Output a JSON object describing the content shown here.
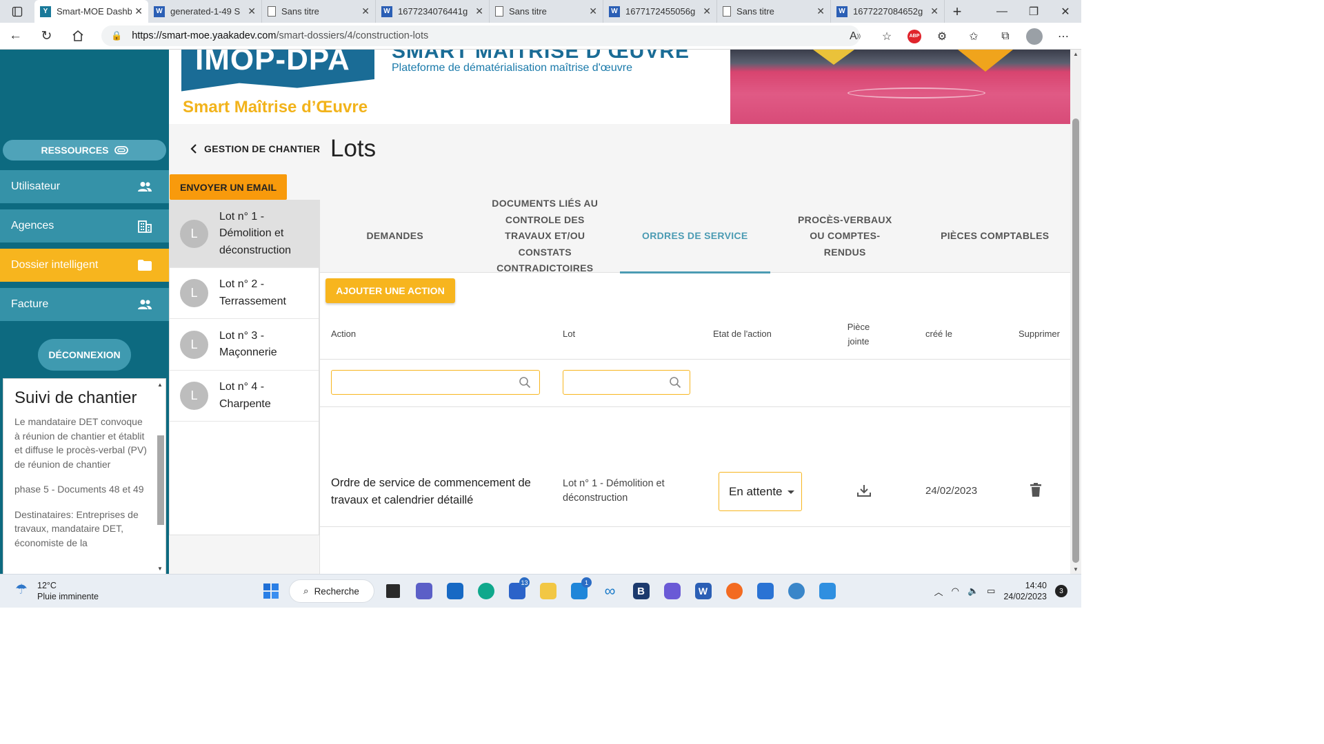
{
  "browser": {
    "tabs": [
      {
        "label": "Smart-MOE Dashb",
        "icon": "yaaka-favicon",
        "active": true
      },
      {
        "label": "generated-1-49 S",
        "icon": "word-favicon"
      },
      {
        "label": "Sans titre",
        "icon": "document-favicon"
      },
      {
        "label": "1677234076441g",
        "icon": "word-favicon"
      },
      {
        "label": "Sans titre",
        "icon": "document-favicon"
      },
      {
        "label": "1677172455056g",
        "icon": "word-favicon"
      },
      {
        "label": "Sans titre",
        "icon": "document-favicon"
      },
      {
        "label": "1677227084652g",
        "icon": "word-favicon"
      }
    ],
    "url_host": "https://smart-moe.yaakadev.com",
    "url_path": "/smart-dossiers/4/construction-lots",
    "abp_label": "ABP"
  },
  "header": {
    "logo_text": "IMOP-DPA",
    "logo_tagline": "Smart Maîtrise d’Œuvre",
    "site_title": "SMART MAÎTRISE D’ŒUVRE",
    "site_subtitle": "Plateforme de dématérialisation maîtrise d'œuvre"
  },
  "sidebar": {
    "resources_label": "RESSOURCES",
    "items": [
      {
        "label": "Utilisateur",
        "icon": "users-icon"
      },
      {
        "label": "Agences",
        "icon": "building-icon"
      },
      {
        "label": "Dossier intelligent",
        "icon": "folder-icon",
        "active": true
      },
      {
        "label": "Facture",
        "icon": "users-icon"
      }
    ],
    "logout_label": "DÉCONNEXION",
    "info": {
      "title": "Suivi de chantier",
      "p1": "Le mandataire DET convoque à réunion de chantier et établit et diffuse le procès-verbal (PV) de réunion de chantier",
      "p2": "phase 5 - Documents 48 et 49",
      "p3": "Destinataires: Entreprises de travaux, mandataire DET, économiste de la"
    }
  },
  "main": {
    "back_label": "GESTION DE CHANTIER",
    "title": "Lots",
    "email_button": "ENVOYER UN EMAIL",
    "lots": [
      {
        "avatar": "L",
        "label": "Lot n° 1 - Démolition et déconstruction",
        "selected": true
      },
      {
        "avatar": "L",
        "label": "Lot n° 2 - Terrassement"
      },
      {
        "avatar": "L",
        "label": "Lot n° 3 - Maçonnerie"
      },
      {
        "avatar": "L",
        "label": "Lot n° 4 - Charpente"
      }
    ],
    "tabs": [
      {
        "label": "DEMANDES"
      },
      {
        "label": "DOCUMENTS LIÉS AU CONTROLE DES TRAVAUX ET/OU CONSTATS CONTRADICTOIRES"
      },
      {
        "label": "ORDRES DE SERVICE",
        "active": true
      },
      {
        "label": "PROCÈS-VERBAUX OU COMPTES-RENDUS"
      },
      {
        "label": "PIÈCES COMPTABLES"
      }
    ],
    "add_action_button": "AJOUTER UNE ACTION",
    "table": {
      "headers": {
        "action": "Action",
        "lot": "Lot",
        "state": "Etat de l'action",
        "attachment": "Pièce jointe",
        "created": "créé le",
        "delete": "Supprimer"
      },
      "rows": [
        {
          "action": "Ordre de service de commencement de travaux et calendrier détaillé",
          "lot": "Lot n° 1 - Démolition et déconstruction",
          "state": "En attente",
          "created": "24/02/2023"
        }
      ]
    }
  },
  "taskbar": {
    "temperature": "12°C",
    "weather": "Pluie imminente",
    "search_label": "Recherche",
    "time": "14:40",
    "date": "24/02/2023",
    "notifications": "3",
    "todo_badge": "13",
    "mail_badge": "1"
  },
  "colors": {
    "sidebar": "#0d6a80",
    "sidebar_item": "#3592a8",
    "accent_yellow": "#f7b51e",
    "accent_orange": "#f89a0c",
    "tab_active": "#4b9bb3"
  }
}
